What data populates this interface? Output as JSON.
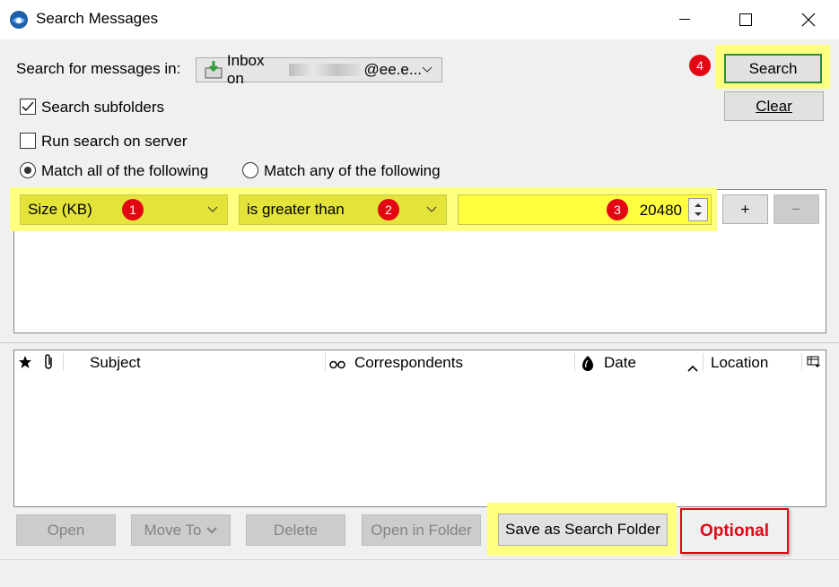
{
  "window": {
    "title": "Search Messages"
  },
  "search_in": {
    "label": "Search for messages in:",
    "folder": "Inbox on",
    "folder_suffix": "@ee.e..."
  },
  "options": {
    "subfolders": {
      "label": "Search subfolders",
      "checked": true
    },
    "server": {
      "label": "Run search on server",
      "checked": false
    },
    "match_all": "Match all of the following",
    "match_any": "Match any of the following"
  },
  "criteria": {
    "field": "Size (KB)",
    "operator": "is greater than",
    "value": "20480",
    "add_label": "+",
    "remove_label": "−"
  },
  "actions": {
    "search": "Search",
    "clear": "Clear"
  },
  "columns": {
    "subject": "Subject",
    "correspondents": "Correspondents",
    "date": "Date",
    "location": "Location"
  },
  "bottom_buttons": {
    "open": "Open",
    "move_to": "Move To",
    "delete": "Delete",
    "open_in_folder": "Open in Folder",
    "save_as_search_folder": "Save as Search Folder"
  },
  "annotations": {
    "badge1": "1",
    "badge2": "2",
    "badge3": "3",
    "badge4": "4",
    "optional": "Optional"
  },
  "colors": {
    "highlight": "#ffff80",
    "badge": "#e30613",
    "optional_text": "#e30613"
  }
}
